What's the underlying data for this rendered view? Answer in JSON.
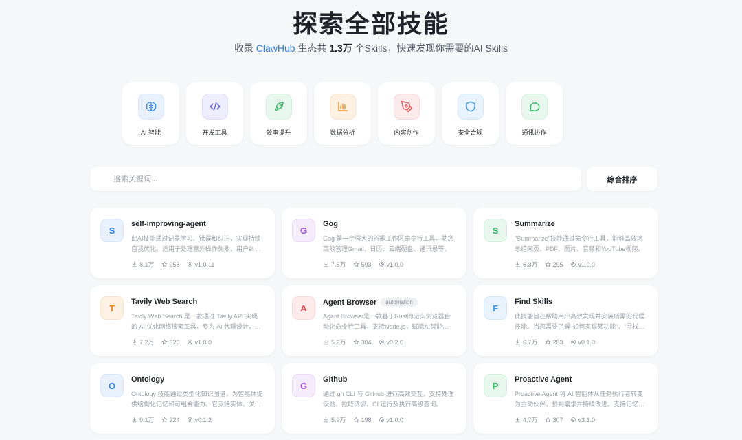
{
  "header": {
    "title": "探索全部技能",
    "subtitle_prefix": "收录 ",
    "brand": "ClawHub",
    "subtitle_mid": " 生态共 ",
    "count": "1.3万",
    "subtitle_suffix": " 个Skills，快速发现你需要的AI Skills"
  },
  "categories": [
    {
      "label": "AI 智能",
      "icon": "brain-icon",
      "color": "#2b7fe6"
    },
    {
      "label": "开发工具",
      "icon": "code-icon",
      "color": "#5b5de3"
    },
    {
      "label": "效率提升",
      "icon": "rocket-icon",
      "color": "#2fb45f"
    },
    {
      "label": "数据分析",
      "icon": "bar-chart-icon",
      "color": "#f08a1c"
    },
    {
      "label": "内容创作",
      "icon": "pen-icon",
      "color": "#e5484d"
    },
    {
      "label": "安全合规",
      "icon": "shield-icon",
      "color": "#3a99e6"
    },
    {
      "label": "通讯协作",
      "icon": "message-icon",
      "color": "#2fb45f"
    }
  ],
  "search": {
    "placeholder": "搜索关键词..."
  },
  "sort": {
    "label": "综合排序"
  },
  "skills": [
    {
      "letter": "S",
      "color": "blue",
      "title": "self-improving-agent",
      "tag": "",
      "desc": "此AI技能通过记录学习、错误和纠正，实现持续自我优化。适用于处理意外操作失败、用户纠正等场景。",
      "downloads": "8.1万",
      "stars": "958",
      "version": "v1.0.11"
    },
    {
      "letter": "G",
      "color": "purple",
      "title": "Gog",
      "tag": "",
      "desc": "Gog 是一个强大的谷歌工作区命令行工具。助您高效管理Gmail、日历、云端硬盘、通讯录等。",
      "downloads": "7.5万",
      "stars": "593",
      "version": "v1.0.0"
    },
    {
      "letter": "S",
      "color": "green",
      "title": "Summarize",
      "tag": "",
      "desc": "\"Summarize\"技能通过命令行工具，能够高效地总结网页、PDF、图片、音频和YouTube视频。",
      "downloads": "6.3万",
      "stars": "295",
      "version": "v1.0.0"
    },
    {
      "letter": "T",
      "color": "orange",
      "title": "Tavily Web Search",
      "tag": "",
      "desc": "Tavily Web Search 是一款通过 Tavily API 实现的 AI 优化网络搜索工具，专为 AI 代理设计，提供简洁相关的结果。",
      "downloads": "7.2万",
      "stars": "320",
      "version": "v1.0.0"
    },
    {
      "letter": "A",
      "color": "red",
      "title": "Agent Browser",
      "tag": "automation",
      "desc": "Agent Browser是一款基于Rust的无头浏览器自动化命令行工具，支持Node.js，赋能AI智能体浏览网页。",
      "downloads": "5.9万",
      "stars": "304",
      "version": "v0.2.0"
    },
    {
      "letter": "F",
      "color": "sky",
      "title": "Find Skills",
      "tag": "",
      "desc": "此技能旨在帮助用户高效发现并安装所需的代理技能。当您需要了解\"如何实现某功能\"、\"寻找某技能\"时使用。",
      "downloads": "6.7万",
      "stars": "283",
      "version": "v0.1.0"
    },
    {
      "letter": "O",
      "color": "blue",
      "title": "Ontology",
      "tag": "",
      "desc": "Ontology 技能通过类型化知识图谱，为智能体提供结构化记忆和可组合能力。它支持实体、关系与约束。",
      "downloads": "9.1万",
      "stars": "224",
      "version": "v0.1.2"
    },
    {
      "letter": "G",
      "color": "purple",
      "title": "Github",
      "tag": "",
      "desc": "通过 gh CLI 与 GitHub 进行高效交互，支持处理议题、拉取请求、CI 运行及执行高级查询。",
      "downloads": "5.9万",
      "stars": "198",
      "version": "v1.0.0"
    },
    {
      "letter": "P",
      "color": "green",
      "title": "Proactive Agent",
      "tag": "",
      "desc": "Proactive Agent 将 AI 智能体从任务执行者转变为主动伙伴，预判需求并持续改进。支持记忆与自主行动。",
      "downloads": "4.7万",
      "stars": "307",
      "version": "v3.1.0"
    }
  ]
}
